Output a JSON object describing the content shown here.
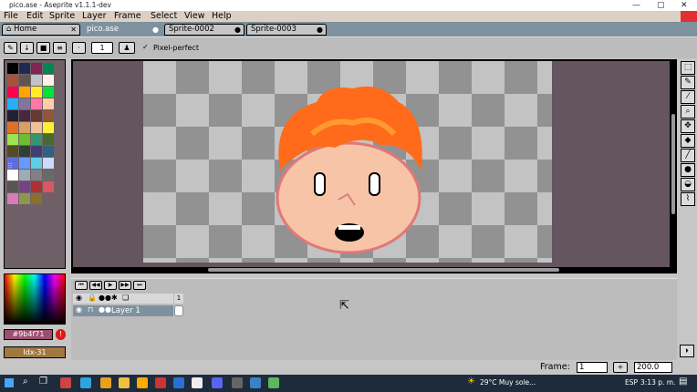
{
  "window": {
    "title": "pico.ase - Aseprite v1.1.1-dev"
  },
  "window_controls": {
    "minimize": "—",
    "maximize": "▢",
    "close": "✕"
  },
  "menu": {
    "file": "File",
    "edit": "Edit",
    "sprite": "Sprite",
    "layer": "Layer",
    "frame": "Frame",
    "select": "Select",
    "view": "View",
    "help": "Help"
  },
  "tabs": [
    {
      "label": "Home",
      "close": "✕"
    },
    {
      "label": "pico.ase",
      "close": "●"
    },
    {
      "label": "Sprite-0002",
      "close": "●"
    },
    {
      "label": "Sprite-0003",
      "close": "●"
    }
  ],
  "context": {
    "brush_size": "1",
    "pixel_perfect_label": "Pixel-perfect",
    "pixel_perfect_check": "✓"
  },
  "palette": {
    "colors": [
      "#000000",
      "#1d2b53",
      "#7e2553",
      "#008751",
      "#ab5236",
      "#5f574f",
      "#c2c3c7",
      "#fff1e8",
      "#ff004d",
      "#ffa300",
      "#ffec27",
      "#00e436",
      "#29adff",
      "#83769c",
      "#ff77a8",
      "#ffccaa",
      "#222034",
      "#45283c",
      "#663931",
      "#8f563b",
      "#df7126",
      "#d9a066",
      "#eec39a",
      "#fbf236",
      "#99e550",
      "#6abe30",
      "#37946e",
      "#4b692f",
      "#524b24",
      "#323c39",
      "#3f3f74",
      "#306082",
      "#5b6ee1",
      "#639bff",
      "#5fcde4",
      "#cbdbfc",
      "#ffffff",
      "#9badb7",
      "#847e87",
      "#696a6a",
      "#595652",
      "#76428a",
      "#ac3232",
      "#d95763",
      "#d77bba",
      "#8f974a",
      "#8a6f30"
    ],
    "resize_marker": "⠿"
  },
  "color_bar": {
    "fg_hex": "#9b4f71",
    "warning": "!",
    "index": "Idx-31"
  },
  "timeline": {
    "buttons": [
      "⏮",
      "◀◀",
      "▶",
      "▶▶",
      "⏭"
    ],
    "frame_number": "1",
    "header_icons": [
      "eye-icon",
      "lock-icon",
      "continuous-icon",
      "gear-icon",
      "layers-icon"
    ],
    "layer_name": "Layer 1"
  },
  "status": {
    "frame_label": "Frame:",
    "frame_value": "1",
    "add": "+",
    "zoom": "200.0"
  },
  "taskbar": {
    "weather": "29°C  Muy sole...",
    "lang": "ESP",
    "time": "3:13 p. m."
  }
}
